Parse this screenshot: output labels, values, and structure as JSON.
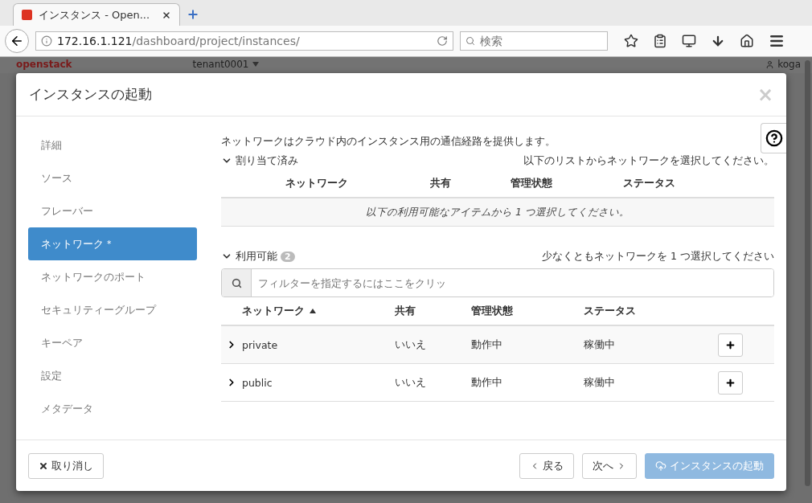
{
  "browser": {
    "tab_title": "インスタンス - Open...",
    "url_host": "172.16.1.121",
    "url_path": "/dashboard/project/instances/",
    "search_placeholder": "検索"
  },
  "dashboard": {
    "brand": "openstack",
    "project": "tenant0001",
    "user": "koga"
  },
  "modal": {
    "title": "インスタンスの起動",
    "close": "×"
  },
  "steps": [
    {
      "label": "詳細",
      "selected": false
    },
    {
      "label": "ソース",
      "selected": false
    },
    {
      "label": "フレーバー",
      "selected": false
    },
    {
      "label": "ネットワーク",
      "selected": true,
      "marker": "*"
    },
    {
      "label": "ネットワークのポート",
      "selected": false
    },
    {
      "label": "セキュリティーグループ",
      "selected": false
    },
    {
      "label": "キーペア",
      "selected": false
    },
    {
      "label": "設定",
      "selected": false
    },
    {
      "label": "メタデータ",
      "selected": false
    }
  ],
  "description": "ネットワークはクラウド内のインスタンス用の通信経路を提供します。",
  "allocated": {
    "label": "割り当て済み",
    "expanded": true,
    "hint": "以下のリストからネットワークを選択してください。",
    "columns": [
      "ネットワーク",
      "共有",
      "管理状態",
      "ステータス"
    ],
    "empty_message": "以下の利用可能なアイテムから 1 つ選択してください。"
  },
  "available": {
    "label": "利用可能",
    "expanded": true,
    "count": "2",
    "hint": "少なくともネットワークを 1 つ選択してください",
    "filter_placeholder": "フィルターを指定するにはここをクリッ",
    "columns": [
      {
        "label": "ネットワーク",
        "sorted": true
      },
      {
        "label": "共有",
        "sorted": false
      },
      {
        "label": "管理状態",
        "sorted": false
      },
      {
        "label": "ステータス",
        "sorted": false
      }
    ],
    "rows": [
      {
        "network": "private",
        "shared": "いいえ",
        "admin_state": "動作中",
        "status": "稼働中",
        "expanded": false
      },
      {
        "network": "public",
        "shared": "いいえ",
        "admin_state": "動作中",
        "status": "稼働中",
        "expanded": false
      }
    ]
  },
  "footer": {
    "cancel": "取り消し",
    "back": "戻る",
    "next": "次へ",
    "launch": "インスタンスの起動",
    "launch_disabled": true
  }
}
